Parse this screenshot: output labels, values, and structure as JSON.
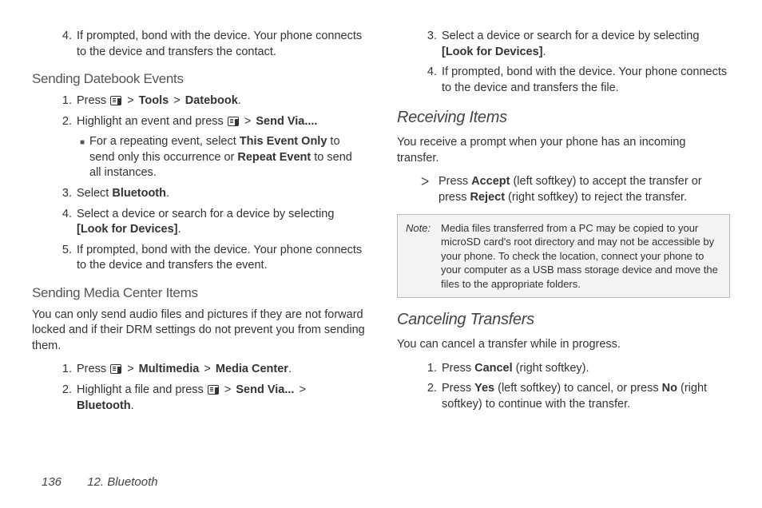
{
  "col1": {
    "step4_top": {
      "num": "4.",
      "text_a": "If prompted, bond with the device. Your phone connects to the device and transfers the contact."
    },
    "h_sde": "Sending Datebook Events",
    "sde_s1": {
      "num": "1.",
      "a": "Press ",
      "b1": "Tools",
      "b2": "Datebook",
      "tail": "."
    },
    "sde_s2": {
      "num": "2.",
      "a": "Highlight an event and press ",
      "b1": "Send Via....",
      "tail": ""
    },
    "sde_sub": {
      "a": "For a repeating event, select ",
      "b1": "This Event Only",
      "mid": " to send only this occurrence or ",
      "b2": "Repeat Event",
      "tail": " to send all instances."
    },
    "sde_s3": {
      "num": "3.",
      "a": "Select ",
      "b1": "Bluetooth",
      "tail": "."
    },
    "sde_s4": {
      "num": "4.",
      "a": "Select a device or search for a device by selecting ",
      "b1": "[Look for Devices]",
      "tail": "."
    },
    "sde_s5": {
      "num": "5.",
      "a": "If prompted, bond with the device. Your phone connects to the device and transfers the event."
    },
    "h_smc": "Sending Media Center Items",
    "smc_para": "You can only send audio files and pictures if they are not forward locked and if their DRM settings do not prevent you from sending them.",
    "smc_s1": {
      "num": "1.",
      "a": "Press ",
      "b1": "Multimedia",
      "b2": "Media Center",
      "tail": "."
    },
    "smc_s2": {
      "num": "2.",
      "a": "Highlight a file and press ",
      "b1": "Send Via...",
      "b2": "Bluetooth",
      "tail": "."
    }
  },
  "col2": {
    "top_s3": {
      "num": "3.",
      "a": "Select a device or search for a device by selecting ",
      "b1": "[Look for Devices]",
      "tail": "."
    },
    "top_s4": {
      "num": "4.",
      "a": "If prompted, bond with the device. Your phone connects to the device and transfers the file."
    },
    "h_ri": "Receiving Items",
    "ri_para": "You receive a prompt when your phone has an incoming transfer.",
    "ri_arrow": {
      "a": "Press ",
      "b1": "Accept",
      "mid": " (left softkey) to accept the transfer or press ",
      "b2": "Reject",
      "tail": " (right softkey) to reject the transfer."
    },
    "note_label": "Note:",
    "note_body": "Media files transferred from a PC may be copied to your microSD card's root directory and may not be accessible by your phone. To check the location, connect your phone to your computer as a USB mass storage device and move the files to the appropriate folders.",
    "h_ct": "Canceling Transfers",
    "ct_para": "You can cancel a transfer while in progress.",
    "ct_s1": {
      "num": "1.",
      "a": "Press ",
      "b1": "Cancel",
      "tail": " (right softkey)."
    },
    "ct_s2": {
      "num": "2.",
      "a": "Press ",
      "b1": "Yes",
      "mid": " (left softkey) to cancel, or press ",
      "b2": "No",
      "tail": " (right softkey) to continue with the transfer."
    }
  },
  "footer": {
    "page": "136",
    "chapter": "12. Bluetooth"
  },
  "glyphs": {
    "gt": ">",
    "bullet": "■",
    "arrow": "ᐳ"
  }
}
